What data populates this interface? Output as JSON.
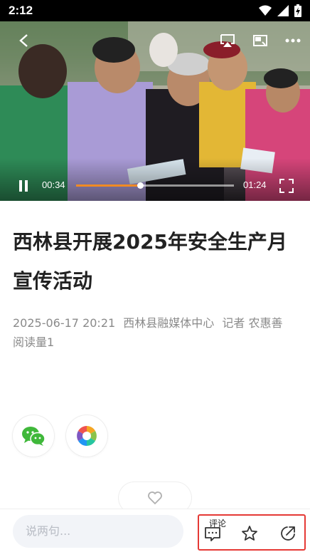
{
  "status_bar": {
    "time": "2:12",
    "icons": [
      "wifi-icon",
      "signal-icon",
      "battery-charging-icon"
    ]
  },
  "video": {
    "current_time": "00:34",
    "total_time": "01:24",
    "progress": 0.405,
    "progress_color": "#f08a24",
    "icons": [
      "back-icon",
      "airplay-icon",
      "picture-in-picture-icon",
      "more-icon",
      "pause-icon",
      "fullscreen-icon"
    ]
  },
  "article": {
    "title": "西林县开展2025年安全生产月宣传活动",
    "date": "2025-06-17 20:21",
    "source": "西林县融媒体中心",
    "reporter": "记者 农惠善",
    "read_count": "阅读量1"
  },
  "share": {
    "items": [
      "wechat-icon",
      "moments-icon"
    ],
    "wechat_color": "#3fb83a"
  },
  "bottom_bar": {
    "comment_placeholder": "说两句...",
    "comment_label": "评论",
    "highlight_color": "#e53935",
    "icons": [
      "comment-icon",
      "star-icon",
      "share-icon"
    ]
  }
}
